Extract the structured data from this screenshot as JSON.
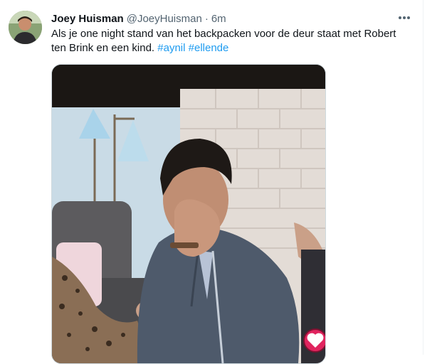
{
  "tweet": {
    "author": {
      "display_name": "Joey Huisman",
      "handle": "@JoeyHuisman",
      "separator": "·",
      "time": "6m"
    },
    "text": {
      "line": "Als je one night stand van het backpacken voor de deur staat met Robert ten Brink en een kind.",
      "hashtags": [
        "#aynil",
        "#ellende"
      ]
    },
    "media": {
      "icon": "heart-icon"
    }
  }
}
